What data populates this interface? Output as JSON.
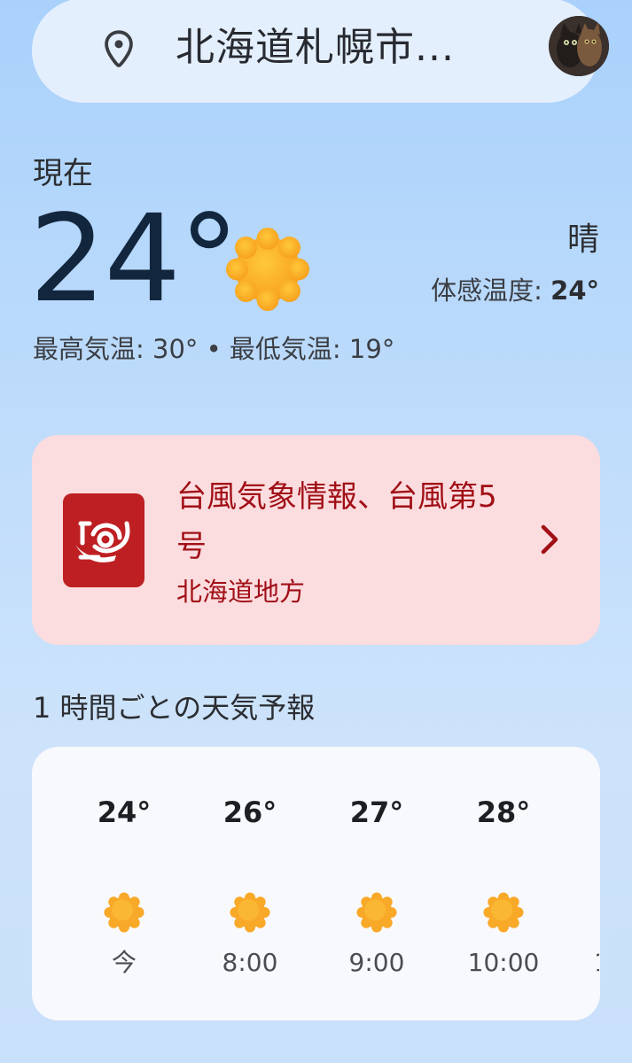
{
  "search": {
    "location": "北海道札幌市...",
    "pin_icon": "location-pin-icon",
    "avatar_icon": "profile-avatar"
  },
  "current": {
    "label": "現在",
    "temperature": "24°",
    "condition": "晴",
    "feels_like_label": "体感温度: ",
    "feels_like_value": "24°",
    "high_low": "最高気温: 30° • 最低気温: 19°",
    "icon": "sun-icon"
  },
  "alert": {
    "title": "台風気象情報、台風第5号",
    "region": "北海道地方",
    "icon": "typhoon-icon",
    "chevron": "chevron-right-icon"
  },
  "hourly": {
    "title": "1 時間ごとの天気予報",
    "hours": [
      {
        "temp": "24°",
        "time": "今",
        "icon": "sun-icon"
      },
      {
        "temp": "26°",
        "time": "8:00",
        "icon": "sun-icon"
      },
      {
        "temp": "27°",
        "time": "9:00",
        "icon": "sun-icon"
      },
      {
        "temp": "28°",
        "time": "10:00",
        "icon": "sun-icon"
      }
    ]
  },
  "colors": {
    "sun": "#fbae25",
    "alert_red": "#be1f23",
    "alert_text": "#a10f16",
    "alert_bg": "#fbdcdf"
  }
}
